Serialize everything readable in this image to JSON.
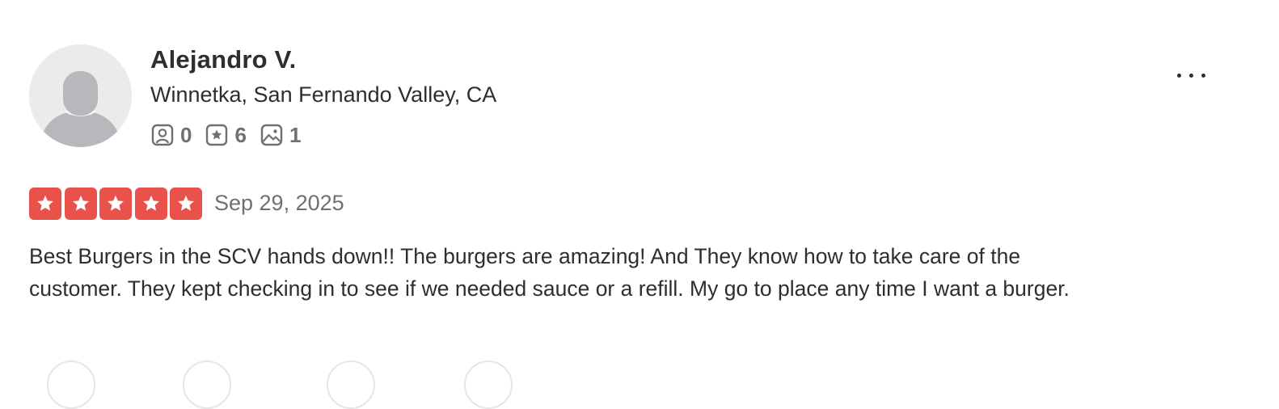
{
  "user": {
    "name": "Alejandro V.",
    "location": "Winnetka, San Fernando Valley, CA",
    "stats": {
      "friends": "0",
      "reviews": "6",
      "photos": "1"
    }
  },
  "review": {
    "rating": 5,
    "date": "Sep 29, 2025",
    "text": "Best Burgers in the SCV hands down!! The burgers are amazing! And They know how to take care of the customer. They kept checking in to see if we needed sauce or a refill. My go to place any time I want a burger."
  },
  "colors": {
    "star_red": "#e8524a",
    "text_primary": "#2d2e2f",
    "text_secondary": "#6e7072",
    "avatar_bg": "#ebebeb"
  },
  "icons": {
    "friends": "friends-icon",
    "reviews": "review-star-icon",
    "photos": "photo-icon",
    "more": "more-options-icon"
  }
}
